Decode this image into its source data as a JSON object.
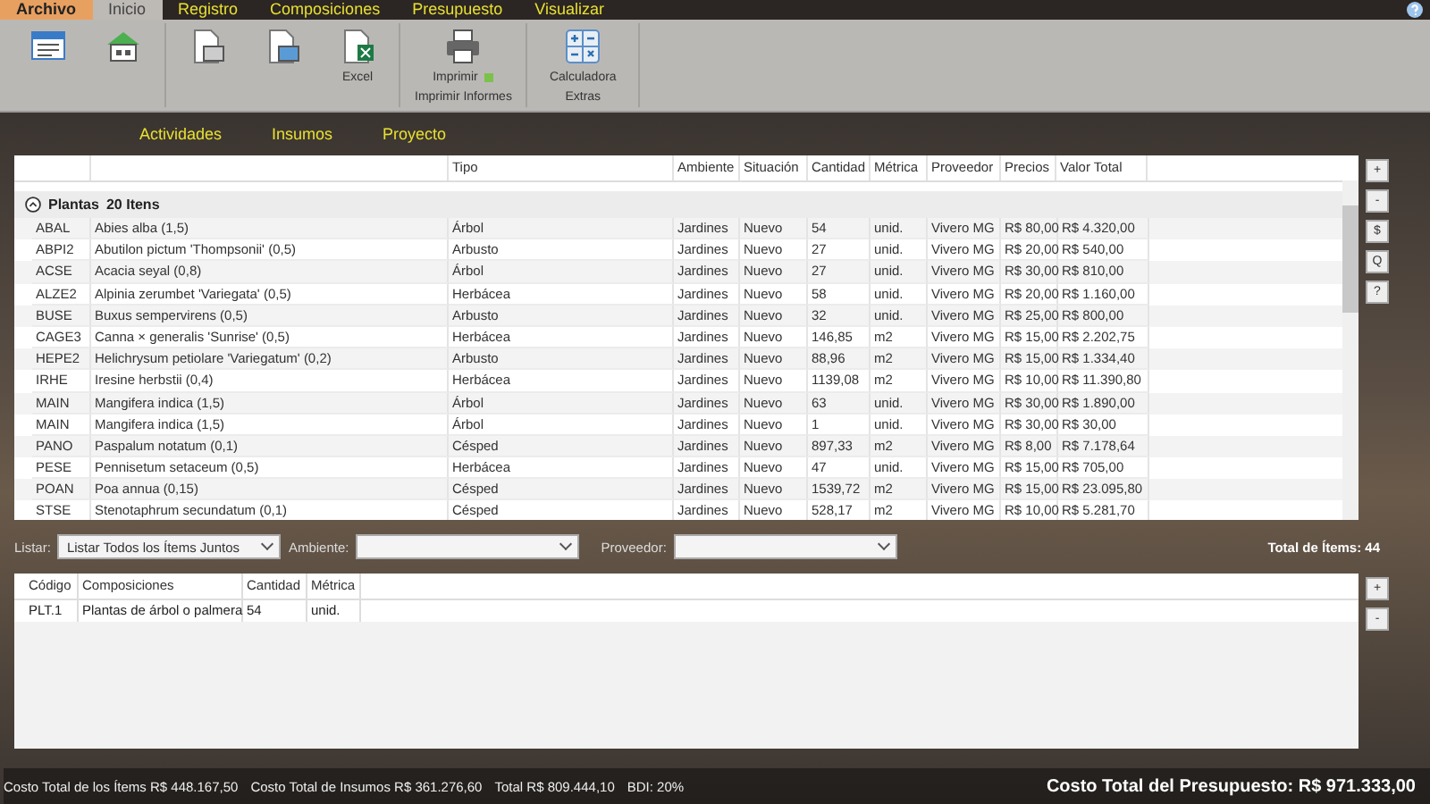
{
  "menu_tabs": [
    {
      "label": "Archivo",
      "kind": "file",
      "selected": false
    },
    {
      "label": "Inicio",
      "kind": "tab",
      "selected": true
    },
    {
      "label": "Registro",
      "kind": "tab",
      "selected": false
    },
    {
      "label": "Composiciones",
      "kind": "tab",
      "selected": false
    },
    {
      "label": "Presupuesto",
      "kind": "tab",
      "selected": false
    },
    {
      "label": "Visualizar",
      "kind": "tab",
      "selected": false
    }
  ],
  "ribbon": {
    "groups": [
      {
        "buttons": [
          {
            "kind": "list"
          },
          {
            "kind": "house"
          }
        ]
      },
      {
        "buttons": [
          {
            "kind": "doc"
          },
          {
            "kind": "doc-table"
          },
          {
            "kind": "excel",
            "label": "Excel"
          }
        ]
      },
      {
        "label": "Imprimir Informes",
        "buttons": [
          {
            "kind": "printer",
            "label": "Imprimir"
          }
        ]
      },
      {
        "label": "Extras",
        "buttons": [
          {
            "kind": "calculator",
            "label": "Calculadora"
          }
        ]
      }
    ]
  },
  "sub_tabs": [
    "Actividades",
    "Insumos",
    "Proyecto"
  ],
  "items_table": {
    "columns": [
      null,
      null,
      "Tipo",
      "Ambiente",
      "Situación",
      "Cantidad",
      "Métrica",
      "Proveedor",
      "Precios",
      "Valor Total"
    ],
    "group": {
      "name": "Plantas",
      "count": "20 Itens",
      "expanded": true
    },
    "rows": [
      [
        "ABAL",
        "Abies alba (1,5)",
        "Árbol",
        "Jardines",
        "Nuevo",
        "54",
        "unid.",
        "Vivero MG",
        "R$ 80,00",
        "R$ 4.320,00"
      ],
      [
        "ABPI2",
        "Abutilon pictum 'Thompsonii' (0,5)",
        "Arbusto",
        "Jardines",
        "Nuevo",
        "27",
        "unid.",
        "Vivero MG",
        "R$ 20,00",
        "R$ 540,00"
      ],
      [
        "ACSE",
        "Acacia seyal (0,8)",
        "Árbol",
        "Jardines",
        "Nuevo",
        "27",
        "unid.",
        "Vivero MG",
        "R$ 30,00",
        "R$ 810,00"
      ],
      [
        "ALZE2",
        "Alpinia zerumbet 'Variegata' (0,5)",
        "Herbácea",
        "Jardines",
        "Nuevo",
        "58",
        "unid.",
        "Vivero MG",
        "R$ 20,00",
        "R$ 1.160,00"
      ],
      [
        "BUSE",
        "Buxus sempervirens (0,5)",
        "Arbusto",
        "Jardines",
        "Nuevo",
        "32",
        "unid.",
        "Vivero MG",
        "R$ 25,00",
        "R$ 800,00"
      ],
      [
        "CAGE3",
        "Canna × generalis 'Sunrise' (0,5)",
        "Herbácea",
        "Jardines",
        "Nuevo",
        "146,85",
        "m2",
        "Vivero MG",
        "R$ 15,00",
        "R$ 2.202,75"
      ],
      [
        "HEPE2",
        "Helichrysum petiolare 'Variegatum' (0,2)",
        "Arbusto",
        "Jardines",
        "Nuevo",
        "88,96",
        "m2",
        "Vivero MG",
        "R$ 15,00",
        "R$ 1.334,40"
      ],
      [
        "IRHE",
        "Iresine herbstii (0,4)",
        "Herbácea",
        "Jardines",
        "Nuevo",
        "1139,08",
        "m2",
        "Vivero MG",
        "R$ 10,00",
        "R$ 11.390,80"
      ],
      [
        "MAIN",
        "Mangifera indica (1,5)",
        "Árbol",
        "Jardines",
        "Nuevo",
        "63",
        "unid.",
        "Vivero MG",
        "R$ 30,00",
        "R$ 1.890,00"
      ],
      [
        "MAIN",
        "Mangifera indica (1,5)",
        "Árbol",
        "Jardines",
        "Nuevo",
        "1",
        "unid.",
        "Vivero MG",
        "R$ 30,00",
        "R$ 30,00"
      ],
      [
        "PANO",
        "Paspalum notatum (0,1)",
        "Césped",
        "Jardines",
        "Nuevo",
        "897,33",
        "m2",
        "Vivero MG",
        "R$ 8,00",
        "R$ 7.178,64"
      ],
      [
        "PESE",
        "Pennisetum setaceum (0,5)",
        "Herbácea",
        "Jardines",
        "Nuevo",
        "47",
        "unid.",
        "Vivero MG",
        "R$ 15,00",
        "R$ 705,00"
      ],
      [
        "POAN",
        "Poa annua (0,15)",
        "Césped",
        "Jardines",
        "Nuevo",
        "1539,72",
        "m2",
        "Vivero MG",
        "R$ 15,00",
        "R$ 23.095,80"
      ],
      [
        "STSE",
        "Stenotaphrum secundatum (0,1)",
        "Césped",
        "Jardines",
        "Nuevo",
        "528,17",
        "m2",
        "Vivero MG",
        "R$ 10,00",
        "R$ 5.281,70"
      ]
    ]
  },
  "side_buttons": [
    "+",
    "-",
    "$",
    "Q",
    "?"
  ],
  "filters": {
    "list": {
      "label": "Listar:",
      "value": "Listar Todos los Ítems Juntos"
    },
    "ambiente": {
      "label": "Ambiente:"
    },
    "proveedor": {
      "label": "Proveedor:"
    },
    "total": "Total de Ítems: 44"
  },
  "compositions_table": {
    "columns": [
      "Código",
      "Composiciones",
      "Cantidad",
      "Métrica"
    ],
    "rows": [
      [
        "PLT.1",
        "Plantas de árbol o palmera",
        "54",
        "unid."
      ]
    ]
  },
  "lower_side_buttons": [
    "+",
    "-"
  ],
  "status_bar": {
    "items": [
      "Costo Total de los Ítems R$ 448.167,50",
      "Costo Total de Insumos R$ 361.276,60",
      "Total R$ 809.444,10",
      "BDI: 20%"
    ],
    "total": "Costo Total del Presupuesto: R$ 971.333,00"
  }
}
